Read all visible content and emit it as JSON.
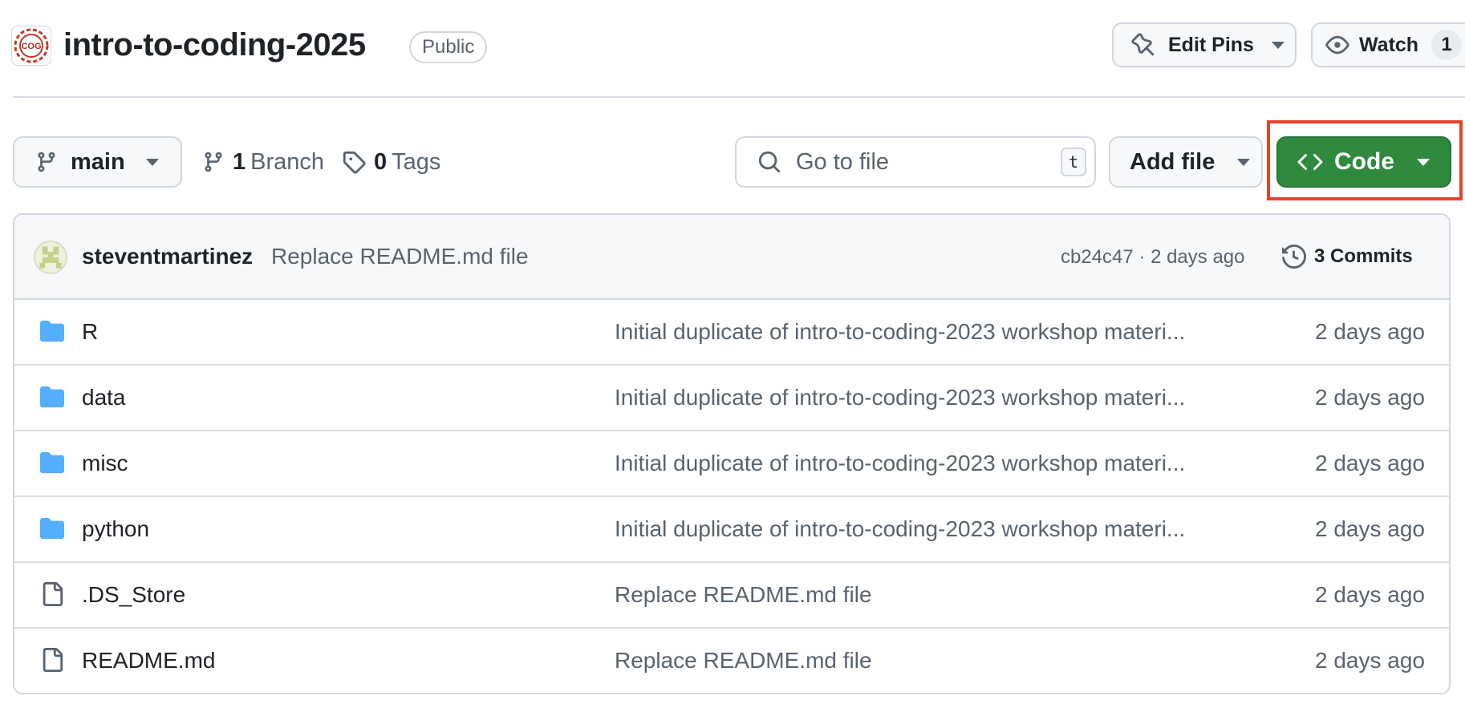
{
  "repo": {
    "avatar_text": "COG",
    "name": "intro-to-coding-2025",
    "visibility": "Public"
  },
  "header_actions": {
    "edit_pins_label": "Edit Pins",
    "watch_label": "Watch",
    "watch_count": "1"
  },
  "toolbar": {
    "branch": "main",
    "branch_count": "1",
    "branch_label": "Branch",
    "tag_count": "0",
    "tag_label": "Tags",
    "search_placeholder": "Go to file",
    "search_shortcut": "t",
    "add_file_label": "Add file",
    "code_label": "Code"
  },
  "latest_commit": {
    "author": "steventmartinez",
    "message": "Replace README.md file",
    "meta": "cb24c47 · 2 days ago",
    "commits_label": "3 Commits"
  },
  "files": [
    {
      "name": "R",
      "type": "folder",
      "message": "Initial duplicate of intro-to-coding-2023 workshop materi...",
      "date": "2 days ago"
    },
    {
      "name": "data",
      "type": "folder",
      "message": "Initial duplicate of intro-to-coding-2023 workshop materi...",
      "date": "2 days ago"
    },
    {
      "name": "misc",
      "type": "folder",
      "message": "Initial duplicate of intro-to-coding-2023 workshop materi...",
      "date": "2 days ago"
    },
    {
      "name": "python",
      "type": "folder",
      "message": "Initial duplicate of intro-to-coding-2023 workshop materi...",
      "date": "2 days ago"
    },
    {
      "name": ".DS_Store",
      "type": "file",
      "message": "Replace README.md file",
      "date": "2 days ago"
    },
    {
      "name": "README.md",
      "type": "file",
      "message": "Replace README.md file",
      "date": "2 days ago"
    }
  ],
  "colors": {
    "code_button": "#2f8a3e",
    "highlight": "#e8432a",
    "folder_icon": "#54aeff"
  }
}
